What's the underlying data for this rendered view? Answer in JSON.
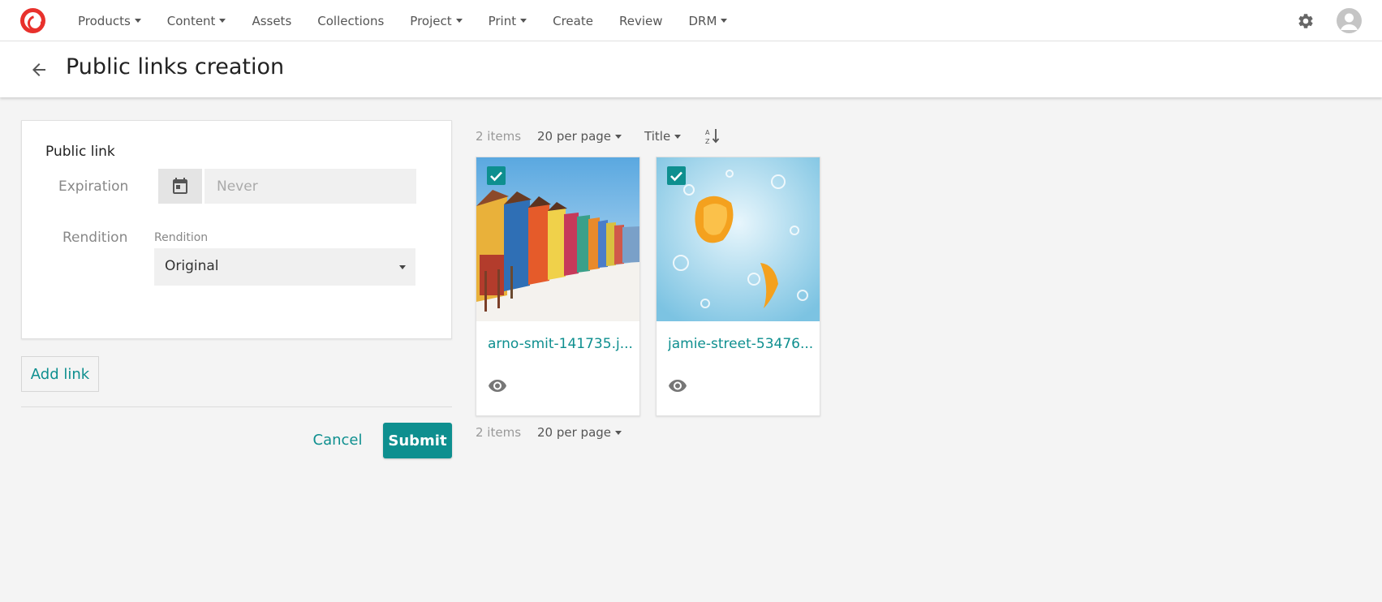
{
  "nav": {
    "items": [
      {
        "label": "Products",
        "dropdown": true
      },
      {
        "label": "Content",
        "dropdown": true
      },
      {
        "label": "Assets",
        "dropdown": false
      },
      {
        "label": "Collections",
        "dropdown": false
      },
      {
        "label": "Project",
        "dropdown": true
      },
      {
        "label": "Print",
        "dropdown": true
      },
      {
        "label": "Create",
        "dropdown": false
      },
      {
        "label": "Review",
        "dropdown": false
      },
      {
        "label": "DRM",
        "dropdown": true
      }
    ],
    "icons": [
      "sitecore-logo-icon",
      "gear-icon",
      "user-avatar-icon"
    ]
  },
  "page": {
    "title": "Public links creation"
  },
  "form": {
    "section_title": "Public link",
    "expiration_label": "Expiration",
    "expiration_placeholder": "Never",
    "expiration_value": "",
    "rendition_label": "Rendition",
    "rendition_field_label": "Rendition",
    "rendition_value": "Original",
    "add_link_label": "Add link",
    "cancel_label": "Cancel",
    "submit_label": "Submit"
  },
  "toolbar": {
    "count": "2 items",
    "per_page": "20 per page",
    "sort_by": "Title"
  },
  "assets": [
    {
      "title": "arno-smit-141735.j...",
      "selected": true,
      "image": "colorful beach huts on sand under blue sky"
    },
    {
      "title": "jamie-street-53476...",
      "selected": true,
      "image": "orange slices splashing in sparkling water"
    }
  ],
  "colors": {
    "accent": "#0e8f8f",
    "brand": "#e8312c"
  }
}
